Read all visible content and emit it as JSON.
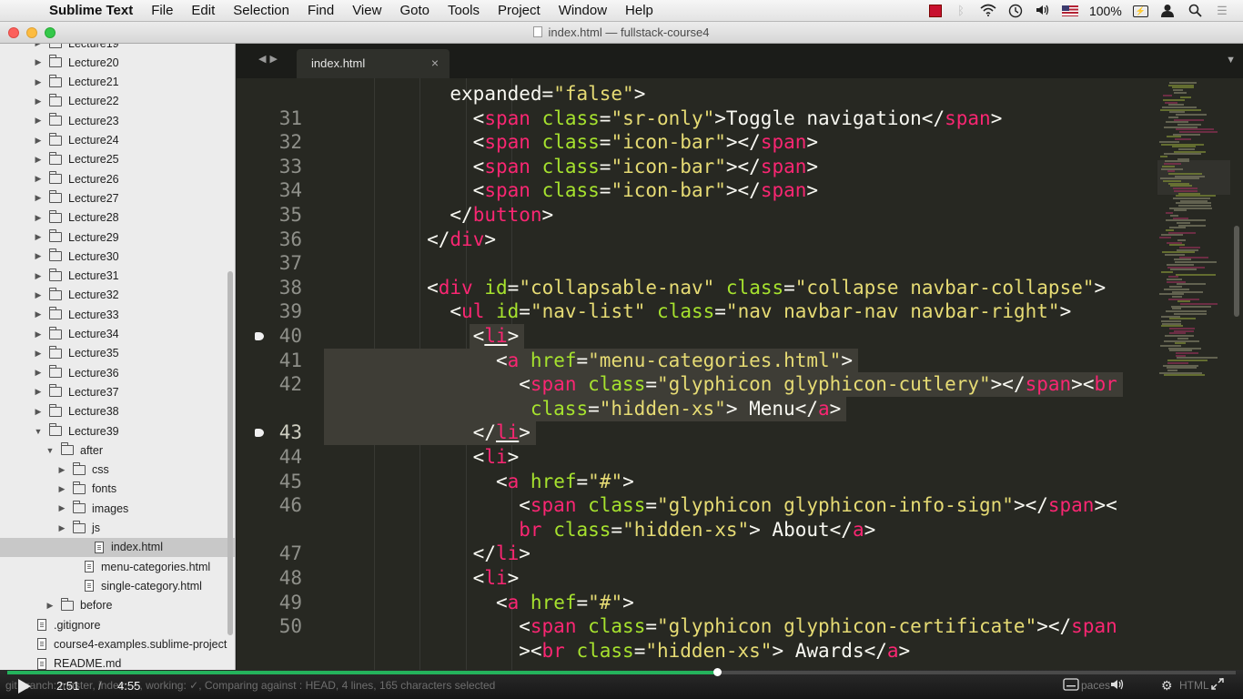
{
  "menubar": {
    "apple_icon": "apple-icon",
    "items": [
      "Sublime Text",
      "File",
      "Edit",
      "Selection",
      "Find",
      "View",
      "Goto",
      "Tools",
      "Project",
      "Window",
      "Help"
    ],
    "battery": "100%",
    "status_icons": [
      "red-square-icon",
      "bluetooth-icon",
      "wifi-icon",
      "time-machine-icon",
      "volume-icon",
      "us-flag-icon",
      "battery-icon",
      "user-icon",
      "search-icon",
      "menu-list-icon"
    ]
  },
  "window": {
    "title": "index.html — fullstack-course4"
  },
  "sidebar": {
    "rows": [
      {
        "label": "Lecture19",
        "type": "folder",
        "depth": 0,
        "open": false
      },
      {
        "label": "Lecture20",
        "type": "folder",
        "depth": 0,
        "open": false
      },
      {
        "label": "Lecture21",
        "type": "folder",
        "depth": 0,
        "open": false
      },
      {
        "label": "Lecture22",
        "type": "folder",
        "depth": 0,
        "open": false
      },
      {
        "label": "Lecture23",
        "type": "folder",
        "depth": 0,
        "open": false
      },
      {
        "label": "Lecture24",
        "type": "folder",
        "depth": 0,
        "open": false
      },
      {
        "label": "Lecture25",
        "type": "folder",
        "depth": 0,
        "open": false
      },
      {
        "label": "Lecture26",
        "type": "folder",
        "depth": 0,
        "open": false
      },
      {
        "label": "Lecture27",
        "type": "folder",
        "depth": 0,
        "open": false
      },
      {
        "label": "Lecture28",
        "type": "folder",
        "depth": 0,
        "open": false
      },
      {
        "label": "Lecture29",
        "type": "folder",
        "depth": 0,
        "open": false
      },
      {
        "label": "Lecture30",
        "type": "folder",
        "depth": 0,
        "open": false
      },
      {
        "label": "Lecture31",
        "type": "folder",
        "depth": 0,
        "open": false
      },
      {
        "label": "Lecture32",
        "type": "folder",
        "depth": 0,
        "open": false
      },
      {
        "label": "Lecture33",
        "type": "folder",
        "depth": 0,
        "open": false
      },
      {
        "label": "Lecture34",
        "type": "folder",
        "depth": 0,
        "open": false
      },
      {
        "label": "Lecture35",
        "type": "folder",
        "depth": 0,
        "open": false
      },
      {
        "label": "Lecture36",
        "type": "folder",
        "depth": 0,
        "open": false
      },
      {
        "label": "Lecture37",
        "type": "folder",
        "depth": 0,
        "open": false
      },
      {
        "label": "Lecture38",
        "type": "folder",
        "depth": 0,
        "open": false
      },
      {
        "label": "Lecture39",
        "type": "folder",
        "depth": 0,
        "open": true
      },
      {
        "label": "after",
        "type": "folder",
        "depth": 1,
        "open": true
      },
      {
        "label": "css",
        "type": "folder",
        "depth": 2,
        "open": false
      },
      {
        "label": "fonts",
        "type": "folder",
        "depth": 2,
        "open": false
      },
      {
        "label": "images",
        "type": "folder",
        "depth": 2,
        "open": false
      },
      {
        "label": "js",
        "type": "folder",
        "depth": 2,
        "open": false
      },
      {
        "label": "index.html",
        "type": "file",
        "depth": 2,
        "selected": true
      },
      {
        "label": "menu-categories.html",
        "type": "file",
        "depth": 2
      },
      {
        "label": "single-category.html",
        "type": "file",
        "depth": 2
      },
      {
        "label": "before",
        "type": "folder",
        "depth": 1,
        "open": false
      },
      {
        "label": ".gitignore",
        "type": "file",
        "depth": 0
      },
      {
        "label": "course4-examples.sublime-project",
        "type": "file",
        "depth": 0
      },
      {
        "label": "README.md",
        "type": "file",
        "depth": 0
      }
    ]
  },
  "tabs": [
    {
      "label": "index.html",
      "close_icon": "close-icon"
    }
  ],
  "editor": {
    "lines": [
      {
        "num": "",
        "indent": 5,
        "tokens": [
          [
            "txt",
            "expanded="
          ],
          [
            "str",
            "\"false\""
          ],
          [
            "txt",
            ">"
          ]
        ]
      },
      {
        "num": "31",
        "indent": 6,
        "tokens": [
          [
            "txt",
            "<"
          ],
          [
            "tag",
            "span"
          ],
          [
            "txt",
            " "
          ],
          [
            "attr",
            "class"
          ],
          [
            "txt",
            "="
          ],
          [
            "str",
            "\"sr-only\""
          ],
          [
            "txt",
            ">Toggle navigation</"
          ],
          [
            "tag",
            "span"
          ],
          [
            "txt",
            ">"
          ]
        ]
      },
      {
        "num": "32",
        "indent": 6,
        "tokens": [
          [
            "txt",
            "<"
          ],
          [
            "tag",
            "span"
          ],
          [
            "txt",
            " "
          ],
          [
            "attr",
            "class"
          ],
          [
            "txt",
            "="
          ],
          [
            "str",
            "\"icon-bar\""
          ],
          [
            "txt",
            "></"
          ],
          [
            "tag",
            "span"
          ],
          [
            "txt",
            ">"
          ]
        ]
      },
      {
        "num": "33",
        "indent": 6,
        "tokens": [
          [
            "txt",
            "<"
          ],
          [
            "tag",
            "span"
          ],
          [
            "txt",
            " "
          ],
          [
            "attr",
            "class"
          ],
          [
            "txt",
            "="
          ],
          [
            "str",
            "\"icon-bar\""
          ],
          [
            "txt",
            "></"
          ],
          [
            "tag",
            "span"
          ],
          [
            "txt",
            ">"
          ]
        ]
      },
      {
        "num": "34",
        "indent": 6,
        "tokens": [
          [
            "txt",
            "<"
          ],
          [
            "tag",
            "span"
          ],
          [
            "txt",
            " "
          ],
          [
            "attr",
            "class"
          ],
          [
            "txt",
            "="
          ],
          [
            "str",
            "\"icon-bar\""
          ],
          [
            "txt",
            "></"
          ],
          [
            "tag",
            "span"
          ],
          [
            "txt",
            ">"
          ]
        ]
      },
      {
        "num": "35",
        "indent": 5,
        "tokens": [
          [
            "txt",
            "</"
          ],
          [
            "tag",
            "button"
          ],
          [
            "txt",
            ">"
          ]
        ]
      },
      {
        "num": "36",
        "indent": 4,
        "tokens": [
          [
            "txt",
            "</"
          ],
          [
            "tag",
            "div"
          ],
          [
            "txt",
            ">"
          ]
        ]
      },
      {
        "num": "37",
        "indent": 0,
        "tokens": []
      },
      {
        "num": "38",
        "indent": 4,
        "tokens": [
          [
            "txt",
            "<"
          ],
          [
            "tag",
            "div"
          ],
          [
            "txt",
            " "
          ],
          [
            "attr",
            "id"
          ],
          [
            "txt",
            "="
          ],
          [
            "str",
            "\"collapsable-nav\""
          ],
          [
            "txt",
            " "
          ],
          [
            "attr",
            "class"
          ],
          [
            "txt",
            "="
          ],
          [
            "str",
            "\"collapse navbar-collapse\""
          ],
          [
            "txt",
            ">"
          ]
        ]
      },
      {
        "num": "39",
        "indent": 5,
        "tokens": [
          [
            "txt",
            "<"
          ],
          [
            "tag",
            "ul"
          ],
          [
            "txt",
            " "
          ],
          [
            "attr",
            "id"
          ],
          [
            "txt",
            "="
          ],
          [
            "str",
            "\"nav-list\""
          ],
          [
            "txt",
            " "
          ],
          [
            "attr",
            "class"
          ],
          [
            "txt",
            "="
          ],
          [
            "str",
            "\"nav navbar-nav navbar-right\""
          ],
          [
            "txt",
            ">"
          ]
        ]
      },
      {
        "num": "40",
        "indent": 6,
        "bookmark": true,
        "hl": [
          6,
          10
        ],
        "tokens": [
          [
            "txt",
            "<"
          ],
          [
            "tagu",
            "li"
          ],
          [
            "txt",
            ">"
          ]
        ]
      },
      {
        "num": "41",
        "indent": 7,
        "hl": [
          0,
          23
        ],
        "tokens": [
          [
            "txt",
            "<"
          ],
          [
            "tag",
            "a"
          ],
          [
            "txt",
            " "
          ],
          [
            "attr",
            "href"
          ],
          [
            "txt",
            "="
          ],
          [
            "str",
            "\"menu-categories.html\""
          ],
          [
            "txt",
            ">"
          ]
        ]
      },
      {
        "num": "42",
        "indent": 8,
        "hl": [
          0,
          34
        ],
        "tokens": [
          [
            "txt",
            "<"
          ],
          [
            "tag",
            "span"
          ],
          [
            "txt",
            " "
          ],
          [
            "attr",
            "class"
          ],
          [
            "txt",
            "="
          ],
          [
            "str",
            "\"glyphicon glyphicon-cutlery\""
          ],
          [
            "txt",
            "></"
          ],
          [
            "tag",
            "span"
          ],
          [
            "txt",
            "><"
          ],
          [
            "tag",
            "br"
          ]
        ]
      },
      {
        "num": "",
        "indent": 8.5,
        "hl": [
          0,
          22
        ],
        "tokens": [
          [
            "attr",
            "class"
          ],
          [
            "txt",
            "="
          ],
          [
            "str",
            "\"hidden-xs\""
          ],
          [
            "txt",
            "> Menu</"
          ],
          [
            "tag",
            "a"
          ],
          [
            "txt",
            ">"
          ]
        ]
      },
      {
        "num": "43",
        "indent": 6,
        "bookmark": true,
        "current": true,
        "hl": [
          0,
          11
        ],
        "tokens": [
          [
            "txt",
            "</"
          ],
          [
            "tagu",
            "li"
          ],
          [
            "txt",
            ">"
          ]
        ]
      },
      {
        "num": "44",
        "indent": 6,
        "tokens": [
          [
            "txt",
            "<"
          ],
          [
            "tag",
            "li"
          ],
          [
            "txt",
            ">"
          ]
        ]
      },
      {
        "num": "45",
        "indent": 7,
        "tokens": [
          [
            "txt",
            "<"
          ],
          [
            "tag",
            "a"
          ],
          [
            "txt",
            " "
          ],
          [
            "attr",
            "href"
          ],
          [
            "txt",
            "="
          ],
          [
            "str",
            "\"#\""
          ],
          [
            "txt",
            ">"
          ]
        ]
      },
      {
        "num": "46",
        "indent": 8,
        "tokens": [
          [
            "txt",
            "<"
          ],
          [
            "tag",
            "span"
          ],
          [
            "txt",
            " "
          ],
          [
            "attr",
            "class"
          ],
          [
            "txt",
            "="
          ],
          [
            "str",
            "\"glyphicon glyphicon-info-sign\""
          ],
          [
            "txt",
            "></"
          ],
          [
            "tag",
            "span"
          ],
          [
            "txt",
            "><"
          ]
        ]
      },
      {
        "num": "",
        "indent": 8,
        "tokens": [
          [
            "tag",
            "br"
          ],
          [
            "txt",
            " "
          ],
          [
            "attr",
            "class"
          ],
          [
            "txt",
            "="
          ],
          [
            "str",
            "\"hidden-xs\""
          ],
          [
            "txt",
            "> About</"
          ],
          [
            "tag",
            "a"
          ],
          [
            "txt",
            ">"
          ]
        ]
      },
      {
        "num": "47",
        "indent": 6,
        "tokens": [
          [
            "txt",
            "</"
          ],
          [
            "tag",
            "li"
          ],
          [
            "txt",
            ">"
          ]
        ]
      },
      {
        "num": "48",
        "indent": 6,
        "tokens": [
          [
            "txt",
            "<"
          ],
          [
            "tag",
            "li"
          ],
          [
            "txt",
            ">"
          ]
        ]
      },
      {
        "num": "49",
        "indent": 7,
        "tokens": [
          [
            "txt",
            "<"
          ],
          [
            "tag",
            "a"
          ],
          [
            "txt",
            " "
          ],
          [
            "attr",
            "href"
          ],
          [
            "txt",
            "="
          ],
          [
            "str",
            "\"#\""
          ],
          [
            "txt",
            ">"
          ]
        ]
      },
      {
        "num": "50",
        "indent": 8,
        "tokens": [
          [
            "txt",
            "<"
          ],
          [
            "tag",
            "span"
          ],
          [
            "txt",
            " "
          ],
          [
            "attr",
            "class"
          ],
          [
            "txt",
            "="
          ],
          [
            "str",
            "\"glyphicon glyphicon-certificate\""
          ],
          [
            "txt",
            "></"
          ],
          [
            "tag",
            "span"
          ]
        ]
      },
      {
        "num": "",
        "indent": 8,
        "tokens": [
          [
            "txt",
            "><"
          ],
          [
            "tag",
            "br"
          ],
          [
            "txt",
            " "
          ],
          [
            "attr",
            "class"
          ],
          [
            "txt",
            "="
          ],
          [
            "str",
            "\"hidden-xs\""
          ],
          [
            "txt",
            "> Awards</"
          ],
          [
            "tag",
            "a"
          ],
          [
            "txt",
            ">"
          ]
        ]
      }
    ]
  },
  "player": {
    "current_time": "2:51",
    "separator": "/",
    "duration": "4:55",
    "progress": 0.578,
    "status_text": "git branch: master, index: ✓, working: ✓, Comparing against : HEAD, 4 lines, 165 characters selected",
    "spaces_label": "paces",
    "syntax_label": "HTML",
    "icons": [
      "play-icon",
      "captions-icon",
      "volume-icon",
      "settings-gear-icon",
      "fullscreen-icon"
    ]
  },
  "colors": {
    "tag": "#f92672",
    "attr": "#a6e22e",
    "string": "#e6db74",
    "text": "#f8f8f2",
    "progress": "#24b35c"
  }
}
